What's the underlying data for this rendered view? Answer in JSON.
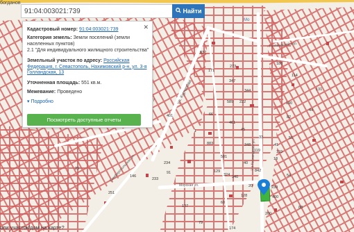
{
  "search": {
    "value": "91:04:003021:739",
    "button_label": "Найти"
  },
  "info": {
    "cad_label": "Кадастровый номер:",
    "cad_value": "91:04:003021:739",
    "cat_label": "Категория земель:",
    "cat_value": "Земли поселений (земли населенных пунктов)",
    "use_value": "2.1 \"Для индивидуального жилищного строительства\"",
    "addr_label": "Земельный участок по адресу:",
    "addr_value": "Российская Федерация, г. Севастополь, Нахимовский р-н, ул. 3-я Голландская, 13",
    "area_label": "Уточненная площадь:",
    "area_value": "551 кв.м.",
    "survey_label": "Межевание:",
    "survey_value": "Проведено",
    "more": "Подробно",
    "reports_button": "Посмотреть доступные отчеты"
  },
  "bottom": {
    "question": "шли участок/дом на карте?"
  },
  "map": {
    "streets": [
      "ул. Курчатова",
      "Голландский пер.",
      "3-я Голландская ул.",
      "Симферопольская ул.",
      "Морская ул."
    ],
    "place_label": "Мо",
    "top_label": "богданов",
    "parcel_numbers": [
      "837",
      "273",
      "589",
      "222",
      "347",
      "401",
      "1",
      "883",
      "180",
      "344",
      "461",
      "581",
      "45",
      "129",
      "340",
      "348",
      "119",
      "40",
      "190",
      "41",
      "131",
      "54",
      "33",
      "82",
      "234",
      "7",
      "324",
      "66",
      "842",
      "20",
      "239",
      "400",
      "110",
      "18",
      "114",
      "60",
      "137",
      "174",
      "55",
      "44",
      "88",
      "200",
      "146",
      "79",
      "233",
      "251",
      "29",
      "91",
      "128",
      "171"
    ]
  }
}
